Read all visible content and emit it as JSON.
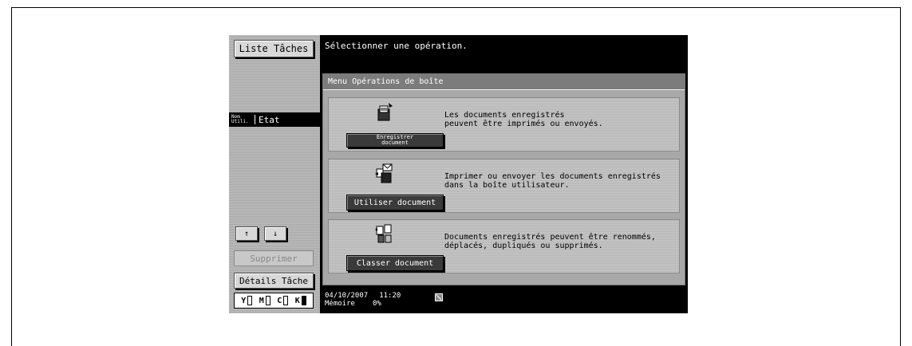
{
  "left_panel": {
    "job_list_label": "Liste Tâches",
    "col_user_label": "Nom\nUtili.",
    "col_status_label": "Etat",
    "up_arrow": "↑",
    "down_arrow": "↓",
    "delete_label": "Supprimer",
    "job_details_label": "Détails Tâche",
    "toners": [
      {
        "letter": "Y"
      },
      {
        "letter": "M"
      },
      {
        "letter": "C"
      },
      {
        "letter": "K"
      }
    ]
  },
  "header": {
    "message": "Sélectionner une opération."
  },
  "panel": {
    "title": "Menu Opérations de boîte",
    "operations": [
      {
        "button_line1": "Enregistrer",
        "button_line2": "document",
        "desc_line1": "Les documents enregistrés",
        "desc_line2": "peuvent être imprimés ou envoyés.",
        "icon": "register-document-icon"
      },
      {
        "button": "Utiliser document",
        "desc_line1": "Imprimer ou envoyer les documents enregistrés",
        "desc_line2": "dans la boîte utilisateur.",
        "icon": "use-document-icon"
      },
      {
        "button": "Classer document",
        "desc_line1": "Documents enregistrés peuvent être renommés,",
        "desc_line2": "déplacés, dupliqués ou supprimés.",
        "icon": "file-document-icon"
      }
    ]
  },
  "status": {
    "date": "04/10/2007",
    "time": "11:20",
    "memory_label": "Mémoire",
    "memory_value": "0%"
  }
}
